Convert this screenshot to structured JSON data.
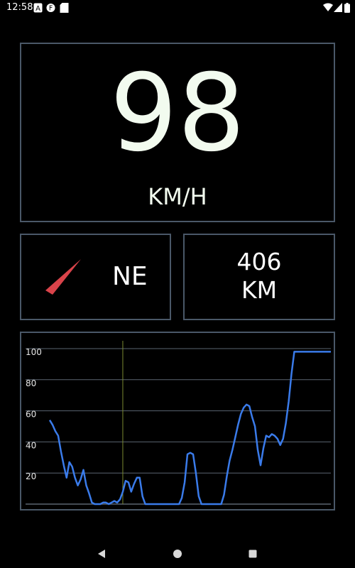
{
  "status_bar": {
    "time": "12:58",
    "icons": [
      "a-notification-icon",
      "f-notification-icon",
      "sd-card-icon"
    ],
    "right_icons": [
      "wifi-icon",
      "signal-icon",
      "battery-icon"
    ]
  },
  "speed": {
    "value": "98",
    "unit": "KM/H"
  },
  "heading": {
    "direction": "NE",
    "arrow_color": "#d9434a"
  },
  "distance": {
    "value": "406",
    "unit": "KM"
  },
  "colors": {
    "panel_border": "#4a5868",
    "speed_text": "#f2fbef",
    "line": "#3a7bea",
    "grid": "#5a6470",
    "marker": "#7a8a30"
  },
  "chart_data": {
    "type": "line",
    "y_ticks": [
      "100",
      "80",
      "60",
      "40",
      "20"
    ],
    "ylim": [
      0,
      100
    ],
    "xlim": [
      0,
      100
    ],
    "marker_x": 26,
    "series": [
      {
        "values": [
          [
            0,
            54
          ],
          [
            1,
            51
          ],
          [
            2,
            47
          ],
          [
            3,
            44
          ],
          [
            4,
            34
          ],
          [
            5,
            25
          ],
          [
            6,
            17
          ],
          [
            7,
            27
          ],
          [
            8,
            24
          ],
          [
            9,
            17
          ],
          [
            10,
            12
          ],
          [
            11,
            16
          ],
          [
            12,
            22
          ],
          [
            13,
            12
          ],
          [
            14,
            7
          ],
          [
            15,
            1
          ],
          [
            16,
            0
          ],
          [
            18,
            0
          ],
          [
            19,
            1
          ],
          [
            20,
            1
          ],
          [
            21,
            0
          ],
          [
            22,
            1
          ],
          [
            23,
            2
          ],
          [
            24,
            1
          ],
          [
            25,
            3
          ],
          [
            26,
            8
          ],
          [
            27,
            15
          ],
          [
            28,
            14
          ],
          [
            29,
            8
          ],
          [
            30,
            13
          ],
          [
            31,
            17
          ],
          [
            32,
            17
          ],
          [
            33,
            5
          ],
          [
            34,
            0
          ],
          [
            36,
            0
          ],
          [
            46,
            0
          ],
          [
            47,
            4
          ],
          [
            48,
            14
          ],
          [
            49,
            32
          ],
          [
            50,
            33
          ],
          [
            51,
            32
          ],
          [
            52,
            20
          ],
          [
            53,
            5
          ],
          [
            54,
            0
          ],
          [
            55,
            0
          ],
          [
            61,
            0
          ],
          [
            62,
            6
          ],
          [
            63,
            18
          ],
          [
            64,
            28
          ],
          [
            65,
            35
          ],
          [
            66,
            43
          ],
          [
            67,
            51
          ],
          [
            68,
            58
          ],
          [
            69,
            62
          ],
          [
            70,
            64
          ],
          [
            71,
            63
          ],
          [
            72,
            56
          ],
          [
            73,
            50
          ],
          [
            74,
            35
          ],
          [
            75,
            25
          ],
          [
            76,
            36
          ],
          [
            77,
            44
          ],
          [
            78,
            43
          ],
          [
            79,
            45
          ],
          [
            80,
            44
          ],
          [
            81,
            42
          ],
          [
            82,
            38
          ],
          [
            83,
            42
          ],
          [
            84,
            52
          ],
          [
            85,
            66
          ],
          [
            86,
            84
          ],
          [
            87,
            98
          ],
          [
            88,
            98
          ],
          [
            89,
            98
          ],
          [
            90,
            98
          ],
          [
            91,
            98
          ],
          [
            92,
            98
          ],
          [
            93,
            98
          ],
          [
            94,
            98
          ],
          [
            95,
            98
          ],
          [
            96,
            98
          ],
          [
            97,
            98
          ],
          [
            98,
            98
          ],
          [
            99,
            98
          ],
          [
            100,
            98
          ]
        ]
      }
    ]
  }
}
